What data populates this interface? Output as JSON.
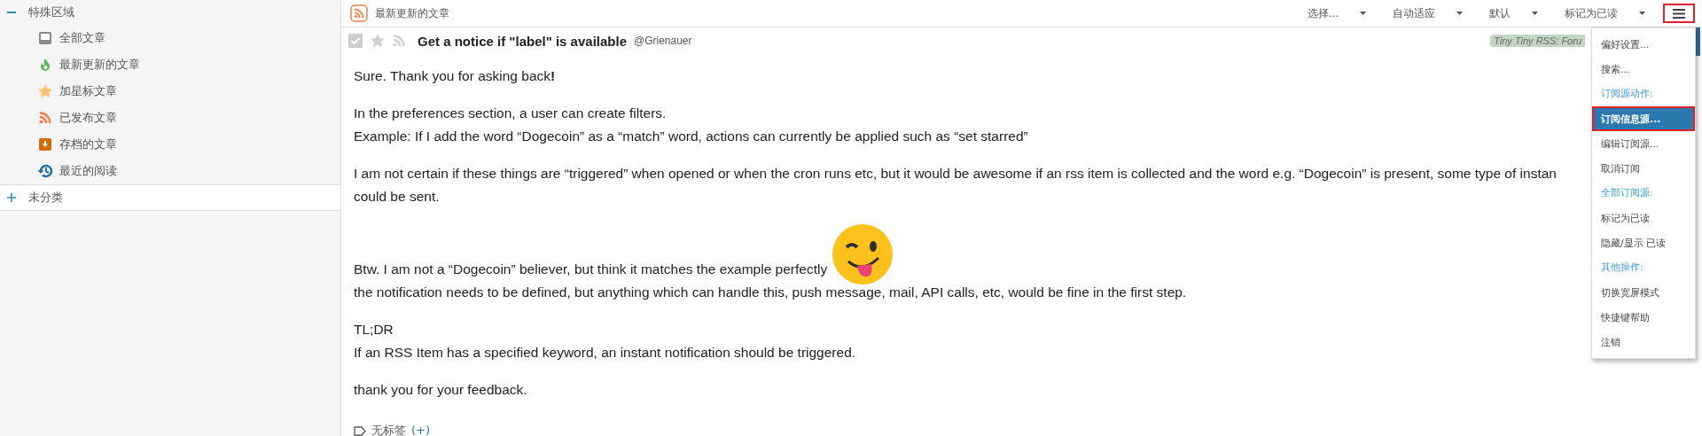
{
  "sidebar": {
    "categories": [
      {
        "title": "特殊区域",
        "expanded": true,
        "children": [
          {
            "title": "全部文章"
          },
          {
            "title": "最新更新的文章"
          },
          {
            "title": "加星标文章"
          },
          {
            "title": "已发布文章"
          },
          {
            "title": "存档的文章"
          },
          {
            "title": "最近的阅读"
          }
        ]
      },
      {
        "title": "未分类",
        "expanded": false
      }
    ]
  },
  "toolbar": {
    "feed_title": "最新更新的文章",
    "dropdowns": [
      "选择...",
      "自动适应",
      "默认",
      "标记为已读"
    ],
    "menu_button": {
      "outlined": true
    }
  },
  "article": {
    "checked": true,
    "starred": false,
    "title": "Get a notice if \"label\" is available",
    "author": "@Grienauer",
    "feed_label": "Tiny Tiny RSS: Foru",
    "paragraphs": [
      {
        "lines": [
          "Sure. Thank you for asking back**!**"
        ]
      },
      {
        "lines": [
          "In the preferences section, a user can create filters.",
          "Example: If I add the word “Dogecoin” as a “match” word, actions can currently be applied such as “set starred”"
        ]
      },
      {
        "lines": [
          "I am not certain if these things are “triggered” when opened or when the cron runs etc, but it would be awesome if an rss item is collected and the word e.g. “Dogecoin” is present, some type of instan",
          "could be sent."
        ]
      },
      {
        "lines": [
          "Btw. I am not a “Dogecoin” believer, but think it matches the example perfectly",
          "the notification needs to be defined, but anything which can handle this, push message, mail, API calls, etc, would be fine in the first step."
        ],
        "emoji": true
      },
      {
        "lines": [
          "TL;DR",
          "If an RSS Item has a specified keyword, an instant notification should be triggered."
        ]
      },
      {
        "lines": [
          "thank you for your feedback."
        ]
      }
    ],
    "tags": "无标签",
    "add_tag": "(+)"
  },
  "menu": {
    "items": [
      {
        "kind": "item",
        "label": "偏好设置...",
        "selected": false,
        "outlined": false
      },
      {
        "kind": "item",
        "label": "搜索...",
        "selected": false,
        "outlined": false
      },
      {
        "kind": "header",
        "label": "订阅源动作:"
      },
      {
        "kind": "item",
        "label": "订阅信息源...",
        "selected": true,
        "outlined": true
      },
      {
        "kind": "item",
        "label": "编辑订阅源...",
        "selected": false,
        "outlined": false
      },
      {
        "kind": "item",
        "label": "取消订阅",
        "selected": false,
        "outlined": false
      },
      {
        "kind": "header",
        "label": "全部订阅源:"
      },
      {
        "kind": "item",
        "label": "标记为已读",
        "selected": false,
        "outlined": false
      },
      {
        "kind": "item",
        "label": "隐藏/显示 已读",
        "selected": false,
        "outlined": false
      },
      {
        "kind": "header",
        "label": "其他操作:"
      },
      {
        "kind": "item",
        "label": "切换宽屏模式",
        "selected": false,
        "outlined": false
      },
      {
        "kind": "item",
        "label": "快捷键帮助",
        "selected": false,
        "outlined": false
      },
      {
        "kind": "item",
        "label": "注销",
        "selected": false,
        "outlined": false
      }
    ]
  }
}
